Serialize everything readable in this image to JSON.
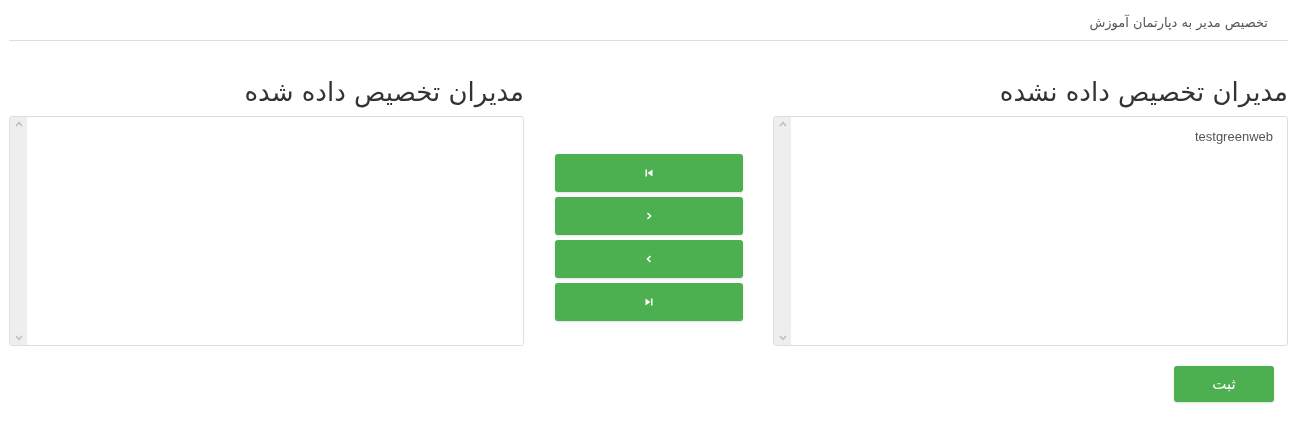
{
  "page_title": "تخصیص مدیر به دپارتمان آموزش",
  "lists": [
    {
      "title": "مدیران تخصیص داده نشده",
      "items": [
        "testgreenweb"
      ]
    },
    {
      "title": "مدیران تخصیص داده شده"
    }
  ],
  "transfer_buttons": [
    {
      "kind": "first"
    },
    {
      "kind": "prev"
    },
    {
      "kind": "next"
    },
    {
      "kind": "last"
    }
  ],
  "submit_button": "ثبت"
}
